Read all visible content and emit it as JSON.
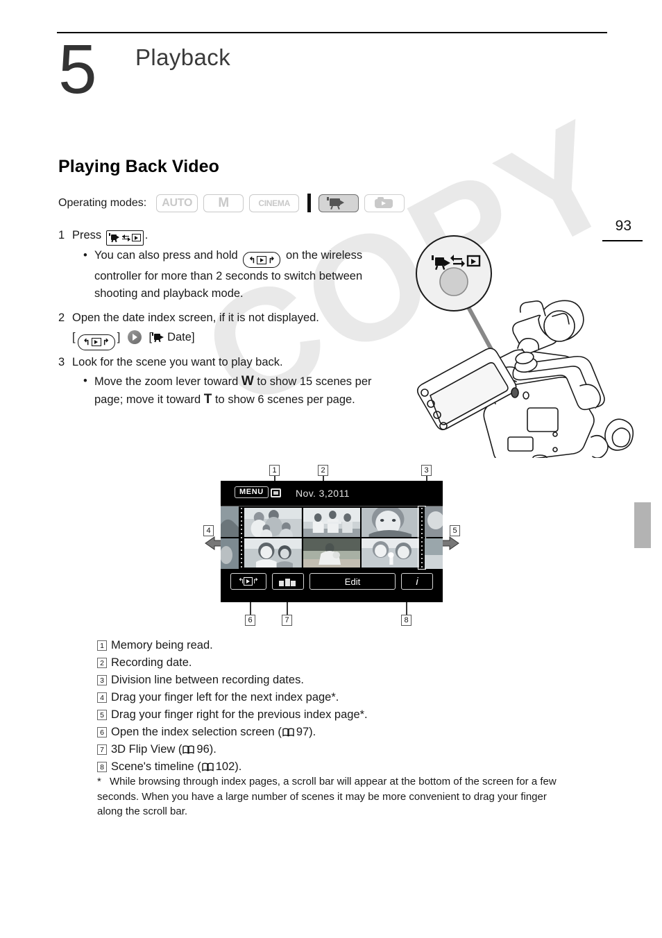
{
  "page": {
    "number": "93",
    "watermark": "COPY"
  },
  "chapter": {
    "number": "5",
    "title": "Playback"
  },
  "section": {
    "title": "Playing Back Video"
  },
  "operating_modes": {
    "label": "Operating modes:",
    "items": [
      {
        "id": "auto",
        "label": "AUTO",
        "type": "text",
        "state": "inactive"
      },
      {
        "id": "manual",
        "label": "M",
        "type": "text",
        "state": "inactive"
      },
      {
        "id": "cinema",
        "label": "CINEMA",
        "type": "text",
        "state": "inactive"
      },
      {
        "id": "video-playback",
        "label": "",
        "icon": "camcorder-playback-icon",
        "type": "icon",
        "state": "active"
      },
      {
        "id": "photo-playback",
        "label": "",
        "icon": "photo-playback-icon",
        "type": "icon",
        "state": "inactive"
      }
    ]
  },
  "steps": [
    {
      "number": "1",
      "text_before": "Press",
      "key_icon": "camera-playback-toggle-key",
      "text_after": ".",
      "bullets": [
        {
          "before": "You can also press and hold",
          "key_icon": "wireless-controller-playback-key",
          "after": "on the wireless controller for more than 2 seconds to switch between shooting and playback mode."
        }
      ]
    },
    {
      "number": "2",
      "text": "Open the date index screen, if it is not displayed.",
      "path": {
        "open_bracket": "[",
        "first_icon": "wireless-playback-icon",
        "close_bracket_1": "]",
        "arrow": "arrow-right-circle-icon",
        "open_bracket_2": "[",
        "second_icon": "movie-icon",
        "label": "Date",
        "close_bracket_2": "]"
      }
    },
    {
      "number": "3",
      "text": "Look for the scene you want to play back.",
      "bullets": [
        {
          "part1": "Move the zoom lever toward",
          "letter1": "W",
          "part2": "to show 15 scenes per page; move it toward",
          "letter2": "T",
          "part3": "to show 6 scenes per page."
        }
      ]
    }
  ],
  "illustration": {
    "callout_icon": "camera-playback-toggle-button",
    "alt": "camcorder with callout showing the camera/playback toggle button"
  },
  "lcd_figure": {
    "menu_label": "MENU",
    "memory_icon": "memory-card-icon",
    "date": "Nov.  3,2011",
    "thumbnails_count": 6,
    "buttons": [
      {
        "id": "index-selection",
        "label": "",
        "icon": "index-selection-icon"
      },
      {
        "id": "flip-view",
        "label": "",
        "icon": "3d-flip-view-icon"
      },
      {
        "id": "edit",
        "label": "Edit",
        "icon": ""
      },
      {
        "id": "info",
        "label": "i",
        "icon": "info-icon"
      }
    ],
    "callouts": [
      "1",
      "2",
      "3",
      "4",
      "5",
      "6",
      "7",
      "8"
    ]
  },
  "legend": [
    {
      "num": "1",
      "text": "Memory being read.",
      "ref": ""
    },
    {
      "num": "2",
      "text": "Recording date.",
      "ref": ""
    },
    {
      "num": "3",
      "text": "Division line between recording dates.",
      "ref": ""
    },
    {
      "num": "4",
      "text": "Drag your finger left for the next index page*.",
      "ref": ""
    },
    {
      "num": "5",
      "text": "Drag your finger right for the previous index page*.",
      "ref": ""
    },
    {
      "num": "6",
      "text_before": "Open the index selection screen (",
      "ref": "97",
      "text_after": ")."
    },
    {
      "num": "7",
      "text_before": "3D Flip View (",
      "ref": "96",
      "text_after": ")."
    },
    {
      "num": "8",
      "text_before": "Scene's timeline (",
      "ref": "102",
      "text_after": ")."
    }
  ],
  "footnote": {
    "marker": "*",
    "text": "While browsing through index pages, a scroll bar will appear at the bottom of the screen for a few seconds. When you have a large number of scenes it may be more convenient to drag your finger along the scroll bar."
  }
}
